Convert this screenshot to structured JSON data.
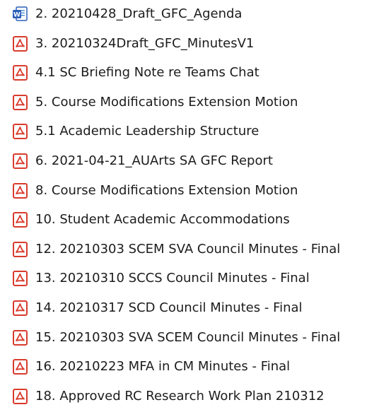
{
  "file_list": {
    "items": [
      {
        "icon": "word-document-icon",
        "name": "2. 20210428_Draft_GFC_Agenda"
      },
      {
        "icon": "pdf-document-icon",
        "name": "3. 20210324Draft_GFC_MinutesV1"
      },
      {
        "icon": "pdf-document-icon",
        "name": "4.1 SC Briefing Note re Teams Chat"
      },
      {
        "icon": "pdf-document-icon",
        "name": "5. Course Modifications Extension Motion"
      },
      {
        "icon": "pdf-document-icon",
        "name": "5.1 Academic Leadership Structure"
      },
      {
        "icon": "pdf-document-icon",
        "name": "6. 2021-04-21_AUArts SA GFC Report"
      },
      {
        "icon": "pdf-document-icon",
        "name": "8. Course Modifications Extension Motion"
      },
      {
        "icon": "pdf-document-icon",
        "name": "10. Student Academic Accommodations"
      },
      {
        "icon": "pdf-document-icon",
        "name": "12. 20210303 SCEM SVA Council Minutes - Final"
      },
      {
        "icon": "pdf-document-icon",
        "name": "13. 20210310 SCCS Council Minutes - Final"
      },
      {
        "icon": "pdf-document-icon",
        "name": "14. 20210317 SCD Council Minutes - Final"
      },
      {
        "icon": "pdf-document-icon",
        "name": "15. 20210303 SVA SCEM Council Minutes - Final"
      },
      {
        "icon": "pdf-document-icon",
        "name": "16. 20210223 MFA in CM Minutes - Final"
      },
      {
        "icon": "pdf-document-icon",
        "name": "18. Approved RC Research Work Plan 210312"
      }
    ]
  },
  "colors": {
    "pdf_red": "#d83b2c",
    "word_blue": "#2b5fb8",
    "text": "#1c1c1c"
  }
}
